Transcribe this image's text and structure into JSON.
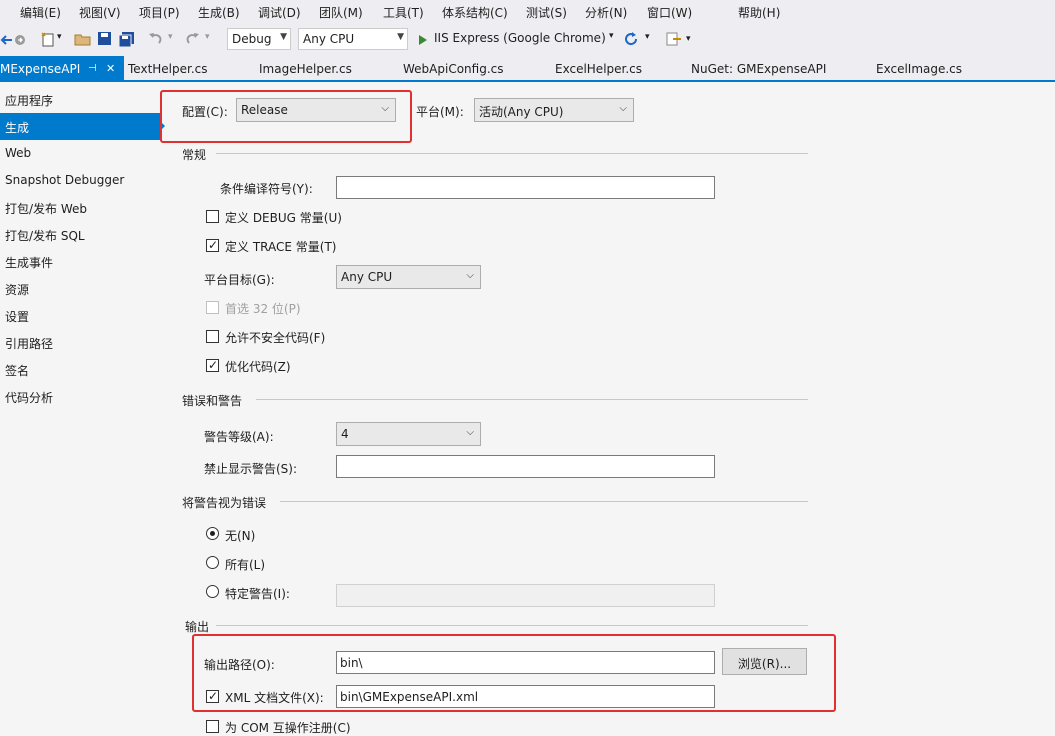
{
  "menu": [
    "编辑(E)",
    "视图(V)",
    "项目(P)",
    "生成(B)",
    "调试(D)",
    "团队(M)",
    "工具(T)",
    "体系结构(C)",
    "测试(S)",
    "分析(N)",
    "窗口(W)",
    "帮助(H)"
  ],
  "toolbar": {
    "config": "Debug",
    "platform": "Any CPU",
    "run_target": "IIS Express (Google Chrome)"
  },
  "tabs": {
    "active": "MExpenseAPI",
    "active_pin": "⊣",
    "active_close": "✕",
    "others": [
      "TextHelper.cs",
      "ImageHelper.cs",
      "WebApiConfig.cs",
      "ExcelHelper.cs",
      "NuGet: GMExpenseAPI",
      "ExcelImage.cs"
    ]
  },
  "sidebar": {
    "selected_index": 1,
    "items": [
      "应用程序",
      "生成",
      "Web",
      "Snapshot Debugger",
      "打包/发布 Web",
      "打包/发布 SQL",
      "生成事件",
      "资源",
      "设置",
      "引用路径",
      "签名",
      "代码分析"
    ]
  },
  "build": {
    "config_label": "配置(C):",
    "config_value": "Release",
    "platform_label": "平台(M):",
    "platform_value": "活动(Any CPU)",
    "general": {
      "header": "常规",
      "symbols_label": "条件编译符号(Y):",
      "symbols_value": "",
      "define_debug_label": "定义 DEBUG 常量(U)",
      "define_debug_checked": false,
      "define_trace_label": "定义 TRACE 常量(T)",
      "define_trace_checked": true,
      "platform_target_label": "平台目标(G):",
      "platform_target_value": "Any CPU",
      "prefer32_label": "首选 32 位(P)",
      "prefer32_checked": false,
      "unsafe_label": "允许不安全代码(F)",
      "unsafe_checked": false,
      "optimize_label": "优化代码(Z)",
      "optimize_checked": true
    },
    "errors": {
      "header": "错误和警告",
      "warning_level_label": "警告等级(A):",
      "warning_level_value": "4",
      "suppress_label": "禁止显示警告(S):",
      "suppress_value": ""
    },
    "treat_warnings": {
      "header": "将警告视为错误",
      "options": [
        "无(N)",
        "所有(L)",
        "特定警告(I):"
      ],
      "selected_index": 0,
      "specific_value": ""
    },
    "output": {
      "header": "输出",
      "path_label": "输出路径(O):",
      "path_value": "bin\\",
      "browse_label": "浏览(R)...",
      "xml_label": "XML 文档文件(X):",
      "xml_checked": true,
      "xml_value": "bin\\GMExpenseAPI.xml",
      "com_label": "为 COM 互操作注册(C)",
      "com_checked": false
    }
  },
  "colors": {
    "accent": "#007acc",
    "highlight": "#e03030"
  }
}
